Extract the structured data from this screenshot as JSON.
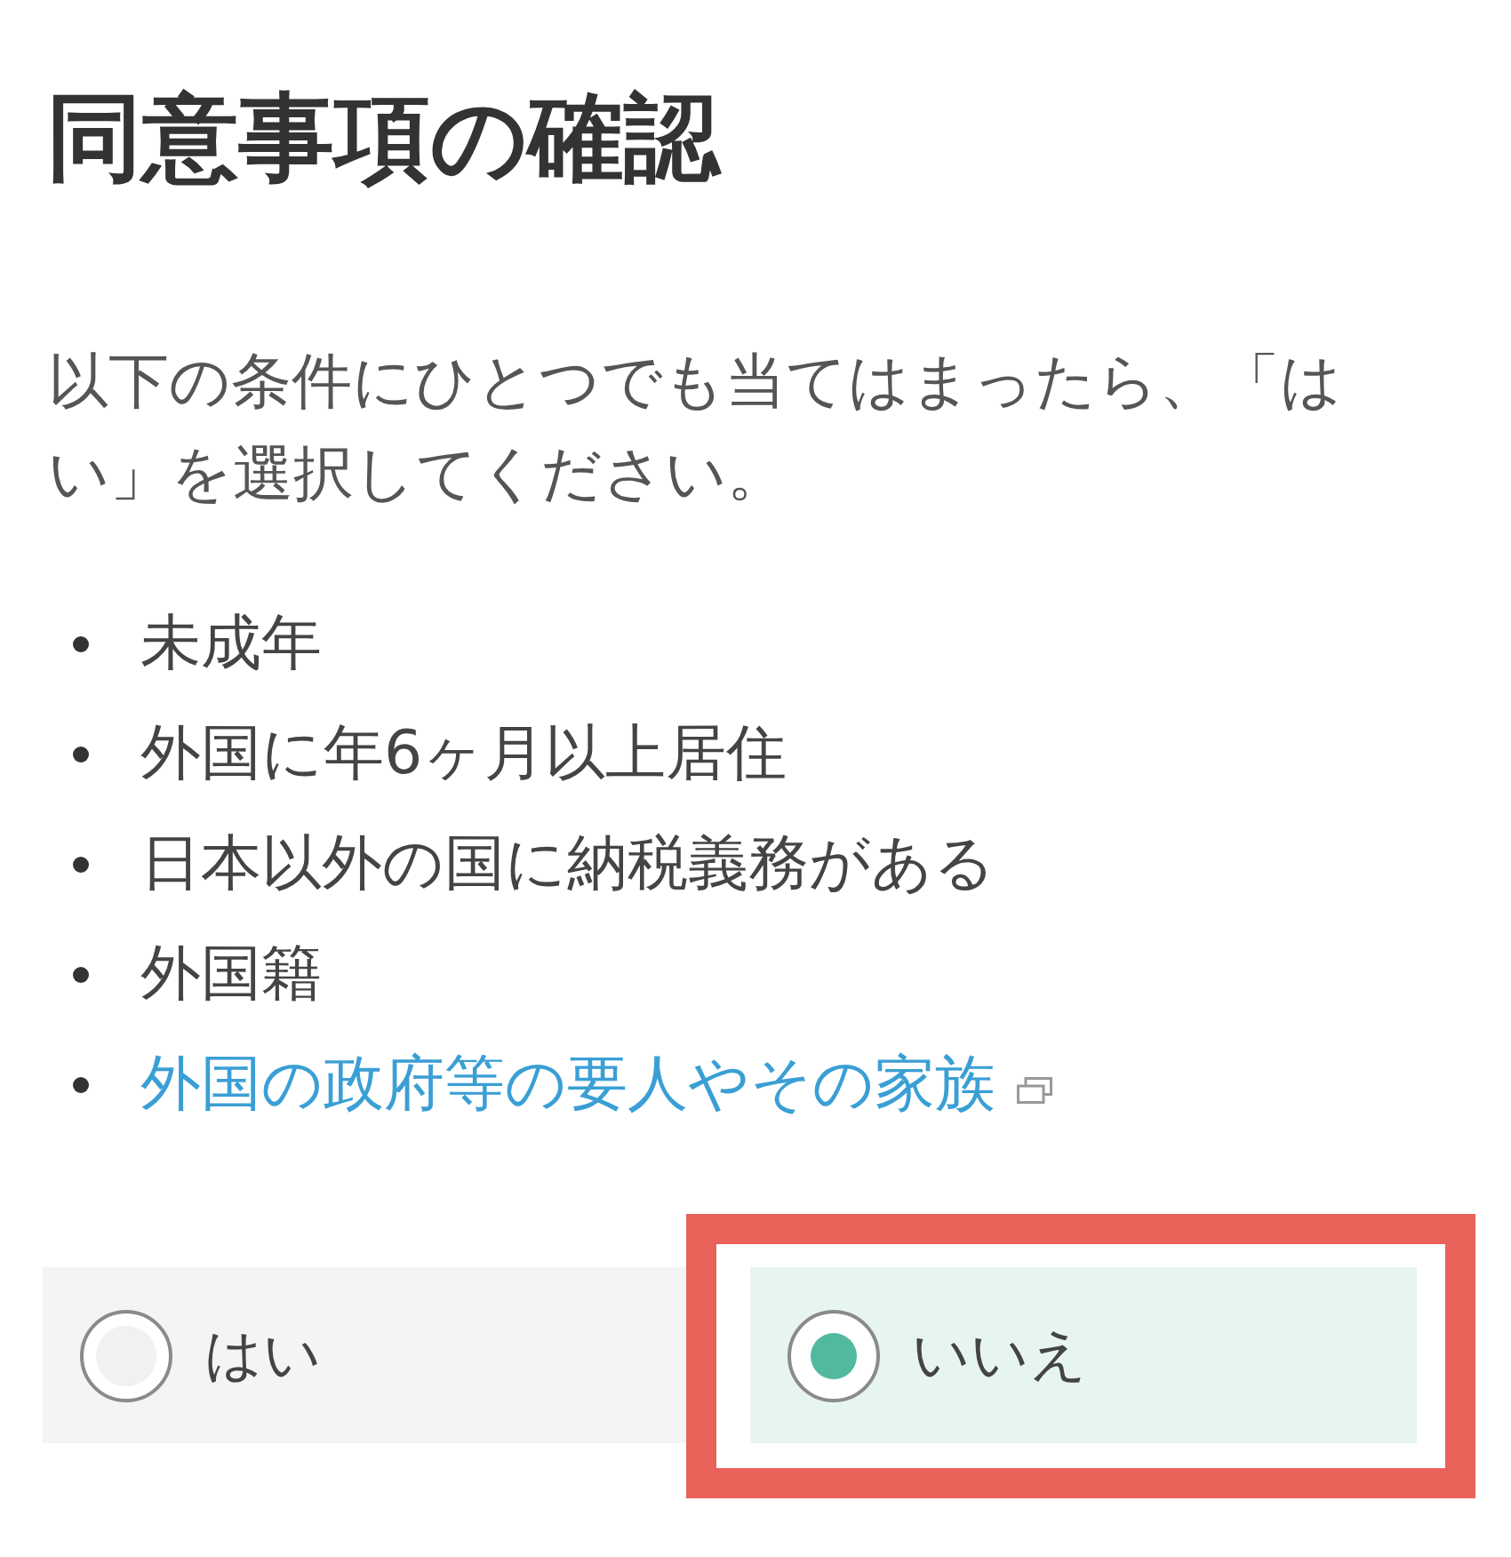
{
  "title": "同意事項の確認",
  "intro": "以下の条件にひとつでも当てはまったら、「はい」を選択してください。",
  "conditions": [
    {
      "kind": "text",
      "text": "未成年"
    },
    {
      "kind": "text",
      "text": "外国に年6ヶ月以上居住"
    },
    {
      "kind": "text",
      "text": "日本以外の国に納税義務がある"
    },
    {
      "kind": "text",
      "text": "外国籍"
    },
    {
      "kind": "link",
      "text": "外国の政府等の要人やその家族"
    }
  ],
  "answer": {
    "options": [
      {
        "label": "はい",
        "selected": false,
        "highlighted": false
      },
      {
        "label": "いいえ",
        "selected": true,
        "highlighted": true
      }
    ]
  }
}
